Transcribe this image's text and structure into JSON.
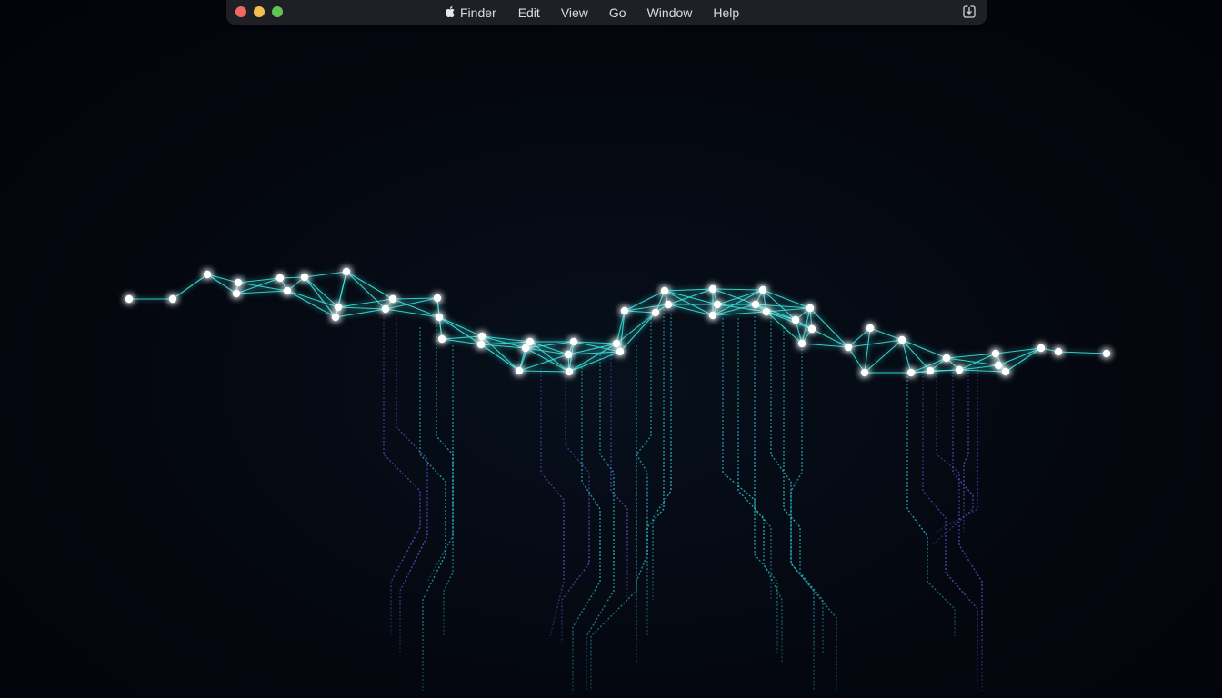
{
  "menubar": {
    "traffic_lights": {
      "close": "#ed6a5e",
      "minimize": "#f5bf4f",
      "zoom": "#61c554"
    },
    "app_icon": "apple-logo-icon",
    "items": [
      "Finder",
      "Edit",
      "View",
      "Go",
      "Window",
      "Help"
    ],
    "right_icon": "square-with-down-arrow-icon"
  },
  "wallpaper": {
    "description_icon": "network-mesh-wallpaper",
    "colors": {
      "background": "#03060d",
      "line": "#3fe6e0",
      "node": "#ffffff",
      "trace_cyan": "#2bc7d6",
      "trace_purple": "#6a4fd8"
    }
  }
}
